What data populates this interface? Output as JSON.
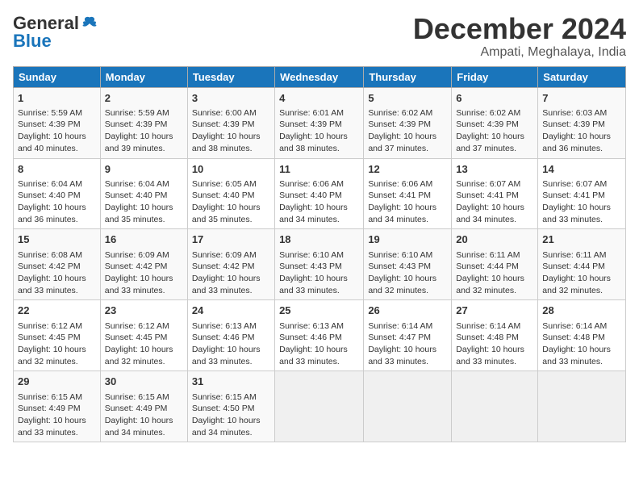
{
  "logo": {
    "general": "General",
    "blue": "Blue"
  },
  "title": "December 2024",
  "subtitle": "Ampati, Meghalaya, India",
  "headers": [
    "Sunday",
    "Monday",
    "Tuesday",
    "Wednesday",
    "Thursday",
    "Friday",
    "Saturday"
  ],
  "weeks": [
    [
      {
        "day": "1",
        "sunrise": "5:59 AM",
        "sunset": "4:39 PM",
        "daylight": "10 hours and 40 minutes."
      },
      {
        "day": "2",
        "sunrise": "5:59 AM",
        "sunset": "4:39 PM",
        "daylight": "10 hours and 39 minutes."
      },
      {
        "day": "3",
        "sunrise": "6:00 AM",
        "sunset": "4:39 PM",
        "daylight": "10 hours and 38 minutes."
      },
      {
        "day": "4",
        "sunrise": "6:01 AM",
        "sunset": "4:39 PM",
        "daylight": "10 hours and 38 minutes."
      },
      {
        "day": "5",
        "sunrise": "6:02 AM",
        "sunset": "4:39 PM",
        "daylight": "10 hours and 37 minutes."
      },
      {
        "day": "6",
        "sunrise": "6:02 AM",
        "sunset": "4:39 PM",
        "daylight": "10 hours and 37 minutes."
      },
      {
        "day": "7",
        "sunrise": "6:03 AM",
        "sunset": "4:39 PM",
        "daylight": "10 hours and 36 minutes."
      }
    ],
    [
      {
        "day": "8",
        "sunrise": "6:04 AM",
        "sunset": "4:40 PM",
        "daylight": "10 hours and 36 minutes."
      },
      {
        "day": "9",
        "sunrise": "6:04 AM",
        "sunset": "4:40 PM",
        "daylight": "10 hours and 35 minutes."
      },
      {
        "day": "10",
        "sunrise": "6:05 AM",
        "sunset": "4:40 PM",
        "daylight": "10 hours and 35 minutes."
      },
      {
        "day": "11",
        "sunrise": "6:06 AM",
        "sunset": "4:40 PM",
        "daylight": "10 hours and 34 minutes."
      },
      {
        "day": "12",
        "sunrise": "6:06 AM",
        "sunset": "4:41 PM",
        "daylight": "10 hours and 34 minutes."
      },
      {
        "day": "13",
        "sunrise": "6:07 AM",
        "sunset": "4:41 PM",
        "daylight": "10 hours and 34 minutes."
      },
      {
        "day": "14",
        "sunrise": "6:07 AM",
        "sunset": "4:41 PM",
        "daylight": "10 hours and 33 minutes."
      }
    ],
    [
      {
        "day": "15",
        "sunrise": "6:08 AM",
        "sunset": "4:42 PM",
        "daylight": "10 hours and 33 minutes."
      },
      {
        "day": "16",
        "sunrise": "6:09 AM",
        "sunset": "4:42 PM",
        "daylight": "10 hours and 33 minutes."
      },
      {
        "day": "17",
        "sunrise": "6:09 AM",
        "sunset": "4:42 PM",
        "daylight": "10 hours and 33 minutes."
      },
      {
        "day": "18",
        "sunrise": "6:10 AM",
        "sunset": "4:43 PM",
        "daylight": "10 hours and 33 minutes."
      },
      {
        "day": "19",
        "sunrise": "6:10 AM",
        "sunset": "4:43 PM",
        "daylight": "10 hours and 32 minutes."
      },
      {
        "day": "20",
        "sunrise": "6:11 AM",
        "sunset": "4:44 PM",
        "daylight": "10 hours and 32 minutes."
      },
      {
        "day": "21",
        "sunrise": "6:11 AM",
        "sunset": "4:44 PM",
        "daylight": "10 hours and 32 minutes."
      }
    ],
    [
      {
        "day": "22",
        "sunrise": "6:12 AM",
        "sunset": "4:45 PM",
        "daylight": "10 hours and 32 minutes."
      },
      {
        "day": "23",
        "sunrise": "6:12 AM",
        "sunset": "4:45 PM",
        "daylight": "10 hours and 32 minutes."
      },
      {
        "day": "24",
        "sunrise": "6:13 AM",
        "sunset": "4:46 PM",
        "daylight": "10 hours and 33 minutes."
      },
      {
        "day": "25",
        "sunrise": "6:13 AM",
        "sunset": "4:46 PM",
        "daylight": "10 hours and 33 minutes."
      },
      {
        "day": "26",
        "sunrise": "6:14 AM",
        "sunset": "4:47 PM",
        "daylight": "10 hours and 33 minutes."
      },
      {
        "day": "27",
        "sunrise": "6:14 AM",
        "sunset": "4:48 PM",
        "daylight": "10 hours and 33 minutes."
      },
      {
        "day": "28",
        "sunrise": "6:14 AM",
        "sunset": "4:48 PM",
        "daylight": "10 hours and 33 minutes."
      }
    ],
    [
      {
        "day": "29",
        "sunrise": "6:15 AM",
        "sunset": "4:49 PM",
        "daylight": "10 hours and 33 minutes."
      },
      {
        "day": "30",
        "sunrise": "6:15 AM",
        "sunset": "4:49 PM",
        "daylight": "10 hours and 34 minutes."
      },
      {
        "day": "31",
        "sunrise": "6:15 AM",
        "sunset": "4:50 PM",
        "daylight": "10 hours and 34 minutes."
      },
      null,
      null,
      null,
      null
    ]
  ]
}
